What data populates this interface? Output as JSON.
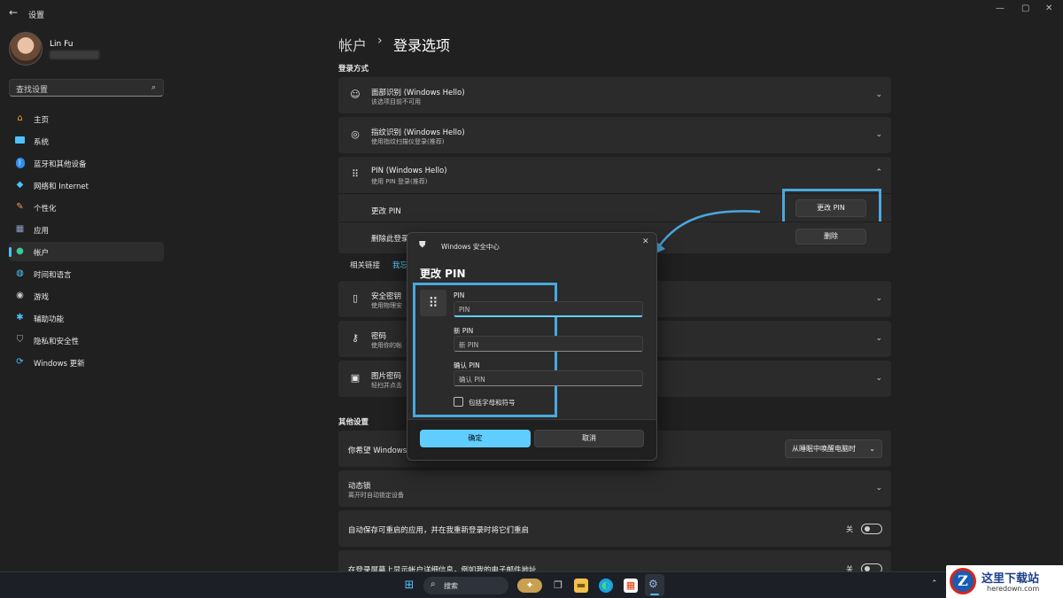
{
  "window": {
    "title": "设置",
    "back": "←",
    "minimize": "—",
    "maximize": "▢",
    "close": "✕"
  },
  "user": {
    "name": "Lin Fu"
  },
  "search": {
    "placeholder": "查找设置"
  },
  "sidebar": {
    "items": [
      {
        "label": "主页",
        "icon": "home-icon"
      },
      {
        "label": "系统",
        "icon": "system-icon"
      },
      {
        "label": "蓝牙和其他设备",
        "icon": "bluetooth-icon"
      },
      {
        "label": "网络和 Internet",
        "icon": "network-icon"
      },
      {
        "label": "个性化",
        "icon": "brush-icon"
      },
      {
        "label": "应用",
        "icon": "apps-icon"
      },
      {
        "label": "帐户",
        "icon": "account-icon"
      },
      {
        "label": "时间和语言",
        "icon": "globe-icon"
      },
      {
        "label": "游戏",
        "icon": "gaming-icon"
      },
      {
        "label": "辅助功能",
        "icon": "accessibility-icon"
      },
      {
        "label": "隐私和安全性",
        "icon": "shield-icon"
      },
      {
        "label": "Windows 更新",
        "icon": "update-icon"
      }
    ]
  },
  "breadcrumb": {
    "parent": "帐户",
    "separator": "›",
    "current": "登录选项"
  },
  "signin": {
    "heading": "登录方式",
    "face": {
      "title": "面部识别 (Windows Hello)",
      "subtitle": "该选项目前不可用"
    },
    "finger": {
      "title": "指纹识别 (Windows Hello)",
      "subtitle": "使用指纹扫描仪登录(推荐)"
    },
    "pin": {
      "title": "PIN (Windows Hello)",
      "subtitle": "使用 PIN 登录(推荐)",
      "change_label": "更改 PIN",
      "change_button": "更改 PIN",
      "remove_label": "删除此登录",
      "remove_button": "删除"
    },
    "related_label": "相关链接",
    "related_link": "我忘",
    "key": {
      "title": "安全密钥",
      "subtitle": "使用物理安"
    },
    "password": {
      "title": "密码",
      "subtitle": "使用你的帐"
    },
    "picture": {
      "title": "图片密码",
      "subtitle": "轻扫并点击"
    }
  },
  "other": {
    "heading": "其他设置",
    "require": {
      "title": "你希望 Windows",
      "dropdown": "从睡眠中唤醒电脑时"
    },
    "dynamic": {
      "title": "动态锁",
      "subtitle": "离开时自动锁定设备"
    },
    "restart": {
      "title": "自动保存可重启的应用，并在我重新登录时将它们重启",
      "state": "关"
    },
    "details": {
      "title": "在登录屏幕上显示帐户详细信息，例如我的电子邮件地址",
      "state": "关"
    }
  },
  "dialog": {
    "caption": "Windows 安全中心",
    "title": "更改 PIN",
    "pin_label": "PIN",
    "pin_placeholder": "PIN",
    "new_label": "新 PIN",
    "new_placeholder": "新 PIN",
    "confirm_label": "确认 PIN",
    "confirm_placeholder": "确认 PIN",
    "checkbox_label": "包括字母和符号",
    "ok": "确定",
    "cancel": "取消"
  },
  "taskbar": {
    "search_placeholder": "搜索"
  },
  "watermark": {
    "title": "这里下载站",
    "url": "heredown.com"
  },
  "colors": {
    "accent": "#4cc2ff",
    "primary_button": "#60cdff",
    "highlight": "#4aa8de"
  }
}
